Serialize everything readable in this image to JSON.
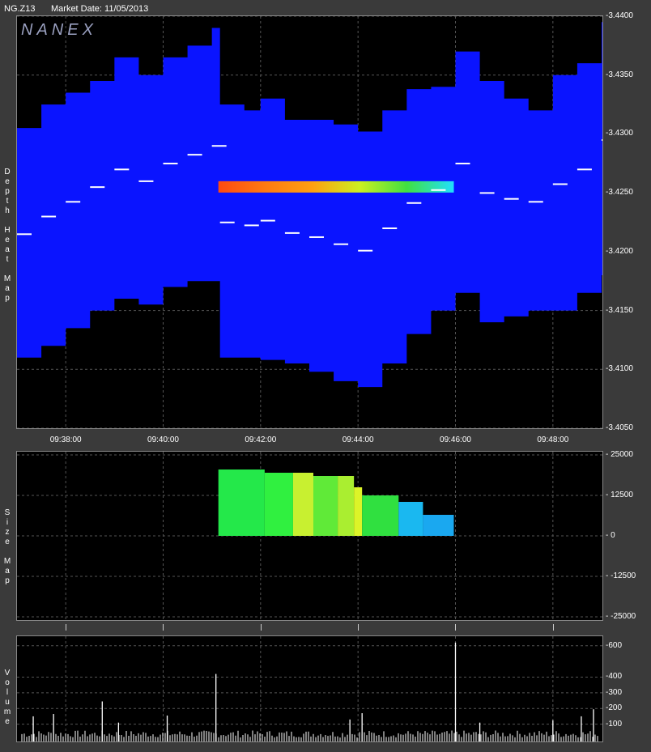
{
  "header": {
    "symbol": "NG.Z13",
    "market_date": "Market Date: 11/05/2013"
  },
  "watermark": "NANEX",
  "panels": {
    "depth": {
      "label": [
        "D",
        "e",
        "p",
        "t",
        "h",
        "",
        "H",
        "e",
        "a",
        "t",
        "",
        "M",
        "a",
        "p"
      ]
    },
    "size": {
      "label": [
        "S",
        "i",
        "z",
        "e",
        "",
        "M",
        "a",
        "p"
      ]
    },
    "volume": {
      "label": [
        "V",
        "o",
        "l",
        "u",
        "m",
        "e"
      ]
    }
  },
  "colors": {
    "heat_blue": "#0a14ff",
    "background": "#000000",
    "frame": "#3a3a3a",
    "band_gradient": [
      "#ff4a10",
      "#ff7a10",
      "#ffa010",
      "#ccf020",
      "#40e040",
      "#20e0ff"
    ]
  },
  "chart_data": [
    {
      "type": "heatmap",
      "name": "Depth Heat Map",
      "x_ticks": [
        "09:38:00",
        "09:40:00",
        "09:42:00",
        "09:44:00",
        "09:46:00",
        "09:48:00"
      ],
      "y_ticks": [
        "3.4400",
        "3.4350",
        "3.4300",
        "3.4250",
        "3.4200",
        "3.4150",
        "3.4100",
        "3.4050"
      ],
      "ylim": [
        3.405,
        3.44
      ],
      "grid": true,
      "bid_ask_band": {
        "price": 3.4255,
        "start": "09:41:08",
        "end": "09:45:58"
      },
      "upper_edge": [
        {
          "t": "09:37:00",
          "p": 3.4305
        },
        {
          "t": "09:37:30",
          "p": 3.4325
        },
        {
          "t": "09:38:00",
          "p": 3.4335
        },
        {
          "t": "09:38:30",
          "p": 3.4345
        },
        {
          "t": "09:39:00",
          "p": 3.4365
        },
        {
          "t": "09:39:30",
          "p": 3.435
        },
        {
          "t": "09:40:00",
          "p": 3.4365
        },
        {
          "t": "09:40:30",
          "p": 3.4375
        },
        {
          "t": "09:41:00",
          "p": 3.439
        },
        {
          "t": "09:41:10",
          "p": 3.4325
        },
        {
          "t": "09:41:40",
          "p": 3.432
        },
        {
          "t": "09:42:00",
          "p": 3.433
        },
        {
          "t": "09:42:30",
          "p": 3.4312
        },
        {
          "t": "09:43:00",
          "p": 3.4312
        },
        {
          "t": "09:43:30",
          "p": 3.4308
        },
        {
          "t": "09:44:00",
          "p": 3.4302
        },
        {
          "t": "09:44:30",
          "p": 3.432
        },
        {
          "t": "09:45:00",
          "p": 3.4338
        },
        {
          "t": "09:45:30",
          "p": 3.434
        },
        {
          "t": "09:46:00",
          "p": 3.437
        },
        {
          "t": "09:46:30",
          "p": 3.4345
        },
        {
          "t": "09:47:00",
          "p": 3.433
        },
        {
          "t": "09:47:30",
          "p": 3.432
        },
        {
          "t": "09:48:00",
          "p": 3.435
        },
        {
          "t": "09:48:30",
          "p": 3.436
        },
        {
          "t": "09:49:00",
          "p": 3.4395
        }
      ],
      "lower_edge": [
        {
          "t": "09:37:00",
          "p": 3.411
        },
        {
          "t": "09:37:30",
          "p": 3.412
        },
        {
          "t": "09:38:00",
          "p": 3.4135
        },
        {
          "t": "09:38:30",
          "p": 3.415
        },
        {
          "t": "09:39:00",
          "p": 3.416
        },
        {
          "t": "09:39:30",
          "p": 3.4155
        },
        {
          "t": "09:40:00",
          "p": 3.417
        },
        {
          "t": "09:40:30",
          "p": 3.4175
        },
        {
          "t": "09:41:00",
          "p": 3.4175
        },
        {
          "t": "09:41:10",
          "p": 3.411
        },
        {
          "t": "09:41:40",
          "p": 3.411
        },
        {
          "t": "09:42:00",
          "p": 3.4108
        },
        {
          "t": "09:42:30",
          "p": 3.4105
        },
        {
          "t": "09:43:00",
          "p": 3.4098
        },
        {
          "t": "09:43:30",
          "p": 3.409
        },
        {
          "t": "09:44:00",
          "p": 3.4085
        },
        {
          "t": "09:44:30",
          "p": 3.4105
        },
        {
          "t": "09:45:00",
          "p": 3.413
        },
        {
          "t": "09:45:30",
          "p": 3.415
        },
        {
          "t": "09:46:00",
          "p": 3.4165
        },
        {
          "t": "09:46:30",
          "p": 3.414
        },
        {
          "t": "09:47:00",
          "p": 3.4145
        },
        {
          "t": "09:47:30",
          "p": 3.415
        },
        {
          "t": "09:48:00",
          "p": 3.415
        },
        {
          "t": "09:48:30",
          "p": 3.4165
        },
        {
          "t": "09:49:00",
          "p": 3.418
        }
      ]
    },
    {
      "type": "area",
      "name": "Size Map",
      "y_ticks": [
        "25000",
        "12500",
        "0",
        "-12500",
        "-25000"
      ],
      "ylim": [
        -25000,
        25000
      ],
      "grid": true,
      "steps": [
        {
          "start": "09:41:08",
          "end": "09:42:05",
          "value": 20500,
          "color": "#24e84a"
        },
        {
          "start": "09:42:05",
          "end": "09:42:40",
          "value": 19500,
          "color": "#30f040"
        },
        {
          "start": "09:42:40",
          "end": "09:43:05",
          "value": 19500,
          "color": "#c8f030"
        },
        {
          "start": "09:43:05",
          "end": "09:43:35",
          "value": 18500,
          "color": "#60ea38"
        },
        {
          "start": "09:43:35",
          "end": "09:43:55",
          "value": 18500,
          "color": "#aaee30"
        },
        {
          "start": "09:43:55",
          "end": "09:44:05",
          "value": 15000,
          "color": "#dcf428"
        },
        {
          "start": "09:44:05",
          "end": "09:44:50",
          "value": 12500,
          "color": "#30e040"
        },
        {
          "start": "09:44:50",
          "end": "09:45:20",
          "value": 10500,
          "color": "#1ab8f0"
        },
        {
          "start": "09:45:20",
          "end": "09:45:58",
          "value": 6500,
          "color": "#1aa8f0"
        }
      ]
    },
    {
      "type": "bar",
      "name": "Volume",
      "y_ticks": [
        "600",
        "400",
        "300",
        "200",
        "100"
      ],
      "ylim": [
        0,
        650
      ],
      "grid": true,
      "spikes": [
        {
          "t": "09:37:20",
          "v": 150
        },
        {
          "t": "09:37:45",
          "v": 165
        },
        {
          "t": "09:38:45",
          "v": 245
        },
        {
          "t": "09:39:05",
          "v": 110
        },
        {
          "t": "09:40:05",
          "v": 155
        },
        {
          "t": "09:41:05",
          "v": 420
        },
        {
          "t": "09:43:50",
          "v": 130
        },
        {
          "t": "09:44:05",
          "v": 170
        },
        {
          "t": "09:46:00",
          "v": 620
        },
        {
          "t": "09:46:30",
          "v": 110
        },
        {
          "t": "09:48:00",
          "v": 125
        },
        {
          "t": "09:48:35",
          "v": 150
        },
        {
          "t": "09:48:50",
          "v": 195
        }
      ]
    }
  ]
}
